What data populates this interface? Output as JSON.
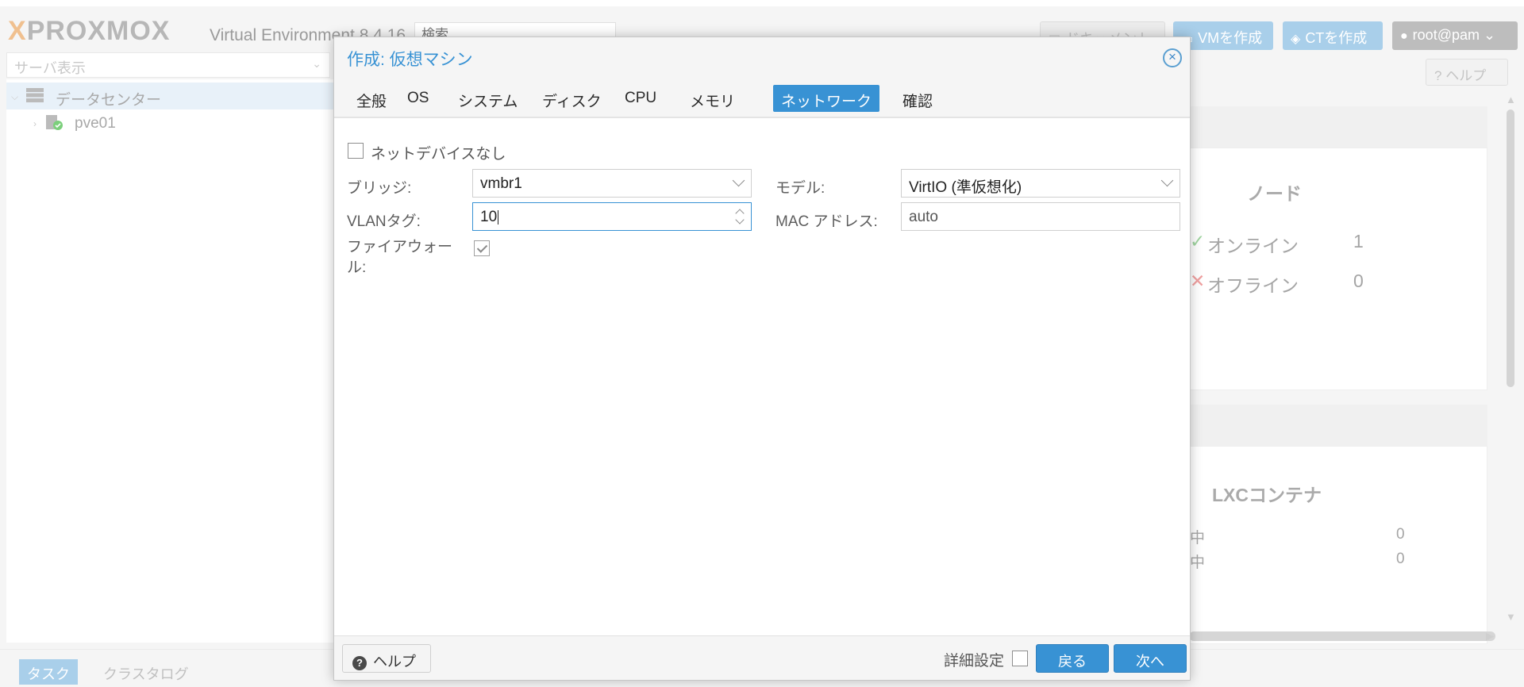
{
  "app": {
    "logo_text": "PROXMOX",
    "version": "Virtual Environment 8.4.16",
    "search_placeholder": "検索",
    "docs_label": "ドキュメント",
    "create_vm_label": "VMを作成",
    "create_ct_label": "CTを作成",
    "user_label": "root@pam"
  },
  "sidebar": {
    "view_selector": "サーバ表示",
    "tree": [
      {
        "label": "データセンター"
      },
      {
        "label": "pve01"
      }
    ]
  },
  "right_panel": {
    "help_label": "ヘルプ",
    "nodes_title": "ノード",
    "online_label": "オンライン",
    "online_count": "1",
    "offline_label": "オフライン",
    "offline_count": "0",
    "lxc_title": "LXCコンテナ",
    "lxc_row1_label": "中",
    "lxc_row1_value": "0",
    "lxc_row2_label": "中",
    "lxc_row2_value": "0"
  },
  "bottom_tabs": {
    "tasks": "タスク",
    "cluster_log": "クラスタログ"
  },
  "dialog": {
    "title": "作成: 仮想マシン",
    "tabs": [
      "全般",
      "OS",
      "システム",
      "ディスク",
      "CPU",
      "メモリ",
      "ネットワーク",
      "確認"
    ],
    "active_tab": "ネットワーク",
    "no_network_label": "ネットデバイスなし",
    "bridge_label": "ブリッジ:",
    "bridge_value": "vmbr1",
    "vlan_label": "VLANタグ:",
    "vlan_value": "10",
    "firewall_label": "ファイアウォール:",
    "firewall_checked": true,
    "model_label": "モデル:",
    "model_value": "VirtIO (準仮想化)",
    "mac_label": "MAC アドレス:",
    "mac_value": "auto",
    "help_button": "ヘルプ",
    "advanced_label": "詳細設定",
    "back_button": "戻る",
    "next_button": "次へ"
  },
  "colors": {
    "accent": "#3892d4",
    "header_bg": "#f5f5f5"
  }
}
